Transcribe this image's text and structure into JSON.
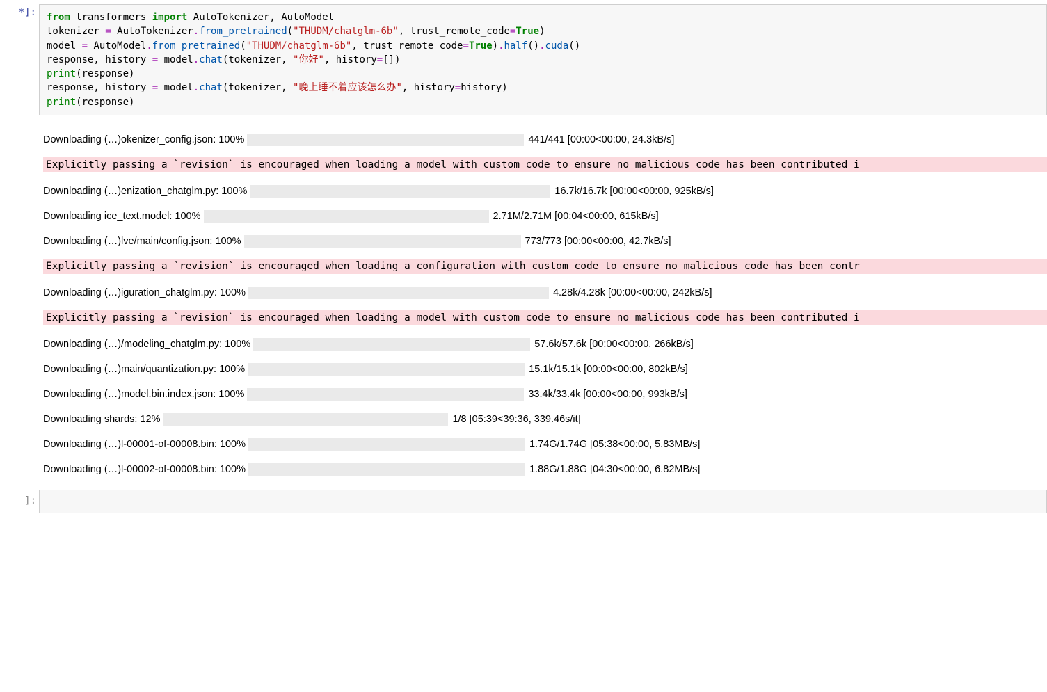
{
  "prompt": {
    "in": "*]:",
    "out": "]:"
  },
  "code": {
    "l1a": "from",
    "l1b": "transformers",
    "l1c": "import",
    "l1d": "AutoTokenizer, AutoModel",
    "l2a": "tokenizer ",
    "l2op": "=",
    "l2b": " AutoTokenizer",
    "l2c": ".",
    "l2d": "from_pretrained",
    "l2e": "(",
    "l2s": "\"THUDM/chatglm-6b\"",
    "l2f": ", trust_remote_code",
    "l2g": "=",
    "l2h": "True",
    "l2i": ")",
    "l3a": "model ",
    "l3b": " AutoModel",
    "l3d": "from_pretrained",
    "l3s": "\"THUDM/chatglm-6b\"",
    "l3i": ")",
    "l3j": ".",
    "l3k": "half",
    "l3l": "()",
    "l3m": ".",
    "l3n": "cuda",
    "l3o": "()",
    "l4a": "response, history ",
    "l4b": " model",
    "l4d": "chat",
    "l4e": "(tokenizer, ",
    "l4s": "\"你好\"",
    "l4f": ", history",
    "l4g": "=",
    "l4h": "[])",
    "l5a": "print",
    "l5b": "(response)",
    "l6a": "response, history ",
    "l6b": " model",
    "l6d": "chat",
    "l6e": "(tokenizer, ",
    "l6s": "\"晚上睡不着应该怎么办\"",
    "l6f": ", history",
    "l6h": "history)",
    "l7a": "print",
    "l7b": "(response)"
  },
  "warn": {
    "w1": "Explicitly passing a `revision` is encouraged when loading a model with custom code to ensure no malicious code has been contributed i",
    "w2": "Explicitly passing a `revision` is encouraged when loading a configuration with custom code to ensure no malicious code has been contr",
    "w3": "Explicitly passing a `revision` is encouraged when loading a model with custom code to ensure no malicious code has been contributed i"
  },
  "rows": {
    "r1": {
      "l": "Downloading (…)okenizer_config.json: 100%",
      "s": "441/441 [00:00<00:00, 24.3kB/s]",
      "p": 100,
      "c": "green",
      "w": "n"
    },
    "r2": {
      "l": "Downloading (…)enization_chatglm.py: 100%",
      "s": "16.7k/16.7k [00:00<00:00, 925kB/s]",
      "p": 100,
      "c": "green",
      "w": "w"
    },
    "r3": {
      "l": "Downloading ice_text.model: 100%",
      "s": "2.71M/2.71M [00:04<00:00, 615kB/s]",
      "p": 100,
      "c": "green",
      "w": "m"
    },
    "r4": {
      "l": "Downloading (…)lve/main/config.json: 100%",
      "s": "773/773 [00:00<00:00, 42.7kB/s]",
      "p": 100,
      "c": "green",
      "w": "n"
    },
    "r5": {
      "l": "Downloading (…)iguration_chatglm.py: 100%",
      "s": "4.28k/4.28k [00:00<00:00, 242kB/s]",
      "p": 100,
      "c": "green",
      "w": "w"
    },
    "r6": {
      "l": "Downloading (…)/modeling_chatglm.py: 100%",
      "s": "57.6k/57.6k [00:00<00:00, 266kB/s]",
      "p": 100,
      "c": "green",
      "w": "n"
    },
    "r7": {
      "l": "Downloading (…)main/quantization.py: 100%",
      "s": "15.1k/15.1k [00:00<00:00, 802kB/s]",
      "p": 100,
      "c": "green",
      "w": "n"
    },
    "r8": {
      "l": "Downloading (…)model.bin.index.json: 100%",
      "s": "33.4k/33.4k [00:00<00:00, 993kB/s]",
      "p": 100,
      "c": "green",
      "w": "n"
    },
    "r9": {
      "l": "Downloading shards: 12%",
      "s": "1/8 [05:39<39:36, 339.46s/it]",
      "p": 12,
      "c": "blue",
      "w": "m"
    },
    "r10": {
      "l": "Downloading (…)l-00001-of-00008.bin: 100%",
      "s": "1.74G/1.74G [05:38<00:00, 5.83MB/s]",
      "p": 100,
      "c": "green",
      "w": "n"
    },
    "r11": {
      "l": "Downloading (…)l-00002-of-00008.bin: 100%",
      "s": "1.88G/1.88G [04:30<00:00, 6.82MB/s]",
      "p": 100,
      "c": "blue",
      "w": "n"
    }
  }
}
